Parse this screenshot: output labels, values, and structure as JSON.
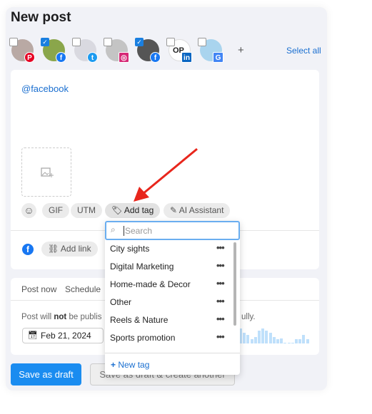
{
  "title": "New post",
  "accounts": [
    {
      "network": "pinterest",
      "checked": false,
      "color": "#e60023",
      "glyph": "P"
    },
    {
      "network": "facebook",
      "checked": true,
      "color": "#1877f2",
      "glyph": "f"
    },
    {
      "network": "twitter",
      "checked": false,
      "color": "#1d9bf0",
      "glyph": "t"
    },
    {
      "network": "instagram",
      "checked": false,
      "color": "#d62976",
      "glyph": "◎"
    },
    {
      "network": "facebook",
      "checked": true,
      "color": "#1877f2",
      "glyph": "f"
    },
    {
      "network": "linkedin",
      "checked": false,
      "color": "#0a66c2",
      "glyph": "in",
      "initials": "OP"
    },
    {
      "network": "google-business",
      "checked": false,
      "color": "#4285f4",
      "glyph": "G"
    }
  ],
  "add_account": "+",
  "select_all": "Select all",
  "editor": {
    "text": "@facebook"
  },
  "toolbar": {
    "gif": "GIF",
    "utm": "UTM",
    "add_tag": "Add tag",
    "ai": "AI Assistant"
  },
  "link": {
    "add_link": "Add link"
  },
  "schedule": {
    "tab_post_now": "Post now",
    "tab_schedule": "Schedule",
    "note_pre": "Post will ",
    "note_bold": "not",
    "note_post": " be publis",
    "note_end": "ully.",
    "date": "Feb 21, 2024"
  },
  "tag_dropdown": {
    "placeholder": "Search",
    "items": [
      "City sights",
      "Digital Marketing",
      "Home-made & Decor",
      "Other",
      "Reels & Nature",
      "Sports promotion"
    ],
    "new_tag": "New tag"
  },
  "buttons": {
    "save_draft": "Save as draft",
    "save_another": "Save as draft & create another"
  },
  "colors": {
    "accent": "#1a8cf0",
    "arrow": "#e8261c"
  }
}
